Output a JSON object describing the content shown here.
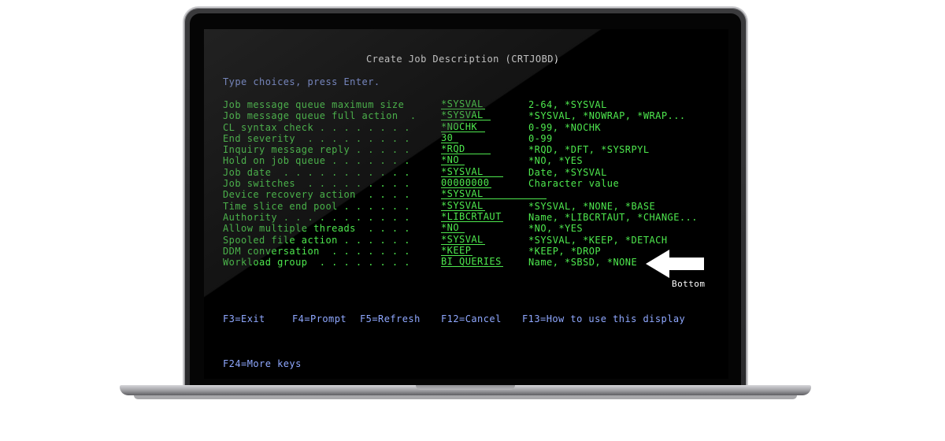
{
  "screen": {
    "title": "Create Job Description (CRTJOBD)",
    "prompt": "Type choices, press Enter.",
    "rows": [
      {
        "label": "Job message queue maximum size",
        "value": "*SYSVAL",
        "value_width": 56,
        "hint": "2-64, *SYSVAL"
      },
      {
        "label": "Job message queue full action  .",
        "value": "*SYSVAL",
        "value_width": 63,
        "hint": "*SYSVAL, *NOWRAP, *WRAP..."
      },
      {
        "label": "CL syntax check . . . . . . . .",
        "value": "*NOCHK",
        "value_width": 56,
        "hint": "0-99, *NOCHK"
      },
      {
        "label": "End severity  . . . . . . . . .",
        "value": "30",
        "value_width": 22,
        "hint": "0-99"
      },
      {
        "label": "Inquiry message reply . . . . .",
        "value": "*RQD",
        "value_width": 63,
        "hint": "*RQD, *DFT, *SYSRPYL"
      },
      {
        "label": "Hold on job queue . . . . . . .",
        "value": "*NO",
        "value_width": 30,
        "hint": "*NO, *YES"
      },
      {
        "label": "Job date  . . . . . . . . . . .",
        "value": "*SYSVAL",
        "value_width": 79,
        "hint": "Date, *SYSVAL"
      },
      {
        "label": "Job switches  . . . . . . . . .",
        "value": "00000000",
        "value_width": 64,
        "hint": "Character value"
      },
      {
        "label": "Device recovery action  . . . .",
        "value": "*SYSVAL",
        "value_width": 134,
        "hint": ""
      },
      {
        "label": "Time slice end pool . . . . . .",
        "value": "*SYSVAL",
        "value_width": 56,
        "hint": "*SYSVAL, *NONE, *BASE"
      },
      {
        "label": "Authority . . . . . . . . . . .",
        "value": "*LIBCRTAUT",
        "value_width": 79,
        "hint": "Name, *LIBCRTAUT, *CHANGE..."
      },
      {
        "label": "Allow multiple threads  . . . .",
        "value": "*NO",
        "value_width": 30,
        "hint": "*NO, *YES"
      },
      {
        "label": "Spooled file action . . . . . .",
        "value": "*SYSVAL",
        "value_width": 56,
        "hint": "*SYSVAL, *KEEP, *DETACH"
      },
      {
        "label": "DDM conversation  . . . . . . .",
        "value": "*KEEP",
        "value_width": 40,
        "hint": "*KEEP, *DROP"
      },
      {
        "label": "Workload group  . . . . . . . .",
        "value": "BI_QUERIES",
        "value_width": 79,
        "hint": "Name, *SBSD, *NONE"
      }
    ],
    "bottom_label": "Bottom",
    "function_keys_line1": [
      {
        "label": "F3=Exit",
        "offset": 0
      },
      {
        "label": "F4=Prompt",
        "offset": 88
      },
      {
        "label": "F5=Refresh",
        "offset": 174
      },
      {
        "label": "F12=Cancel",
        "offset": 277
      },
      {
        "label": "F13=How to use this display",
        "offset": 380
      }
    ],
    "function_keys_line2": "F24=More keys"
  },
  "colors": {
    "field_text": "#4ee84e",
    "prompt_text": "#8fa8ff",
    "title_text": "#ffffff",
    "screen_bg": "#000000"
  },
  "icons": {
    "callout": "arrow-left-icon"
  }
}
